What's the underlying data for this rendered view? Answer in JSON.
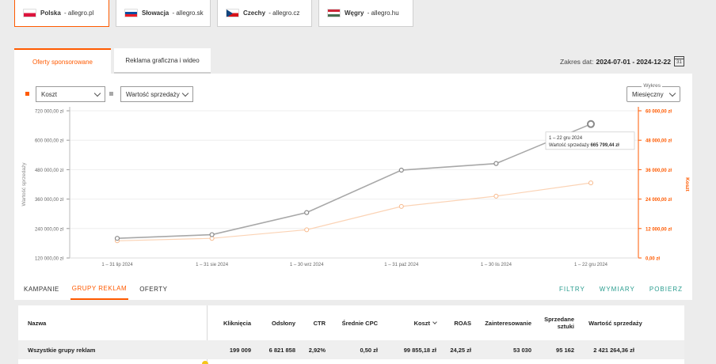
{
  "markets": [
    {
      "country": "Polska",
      "domain": "allegro.pl",
      "flag": "pl",
      "active": true
    },
    {
      "country": "Słowacja",
      "domain": "allegro.sk",
      "flag": "sk",
      "active": false
    },
    {
      "country": "Czechy",
      "domain": "allegro.cz",
      "flag": "cz",
      "active": false
    },
    {
      "country": "Węgry",
      "domain": "allegro.hu",
      "flag": "hu",
      "active": false
    }
  ],
  "tabs": {
    "sponsored": "Oferty sponsorowane",
    "display": "Reklama graficzna i wideo"
  },
  "date_range": {
    "label": "Zakres dat:",
    "value": "2024-07-01 - 2024-12-22",
    "calendar_day": "31"
  },
  "selectors": {
    "metric1": "Koszt",
    "metric2": "Wartość sprzedaży",
    "chart_legend": "Wykres",
    "chart_period": "Miesięczny"
  },
  "colors": {
    "accent": "#ff5a00",
    "sales_line": "#a8a8a8",
    "cost_line": "#fbd3b5",
    "teal": "#2a9d8f"
  },
  "chart_data": {
    "type": "line",
    "categories": [
      "1 – 31 lip 2024",
      "1 – 31 sie 2024",
      "1 – 30 wrz 2024",
      "1 – 31 paź 2024",
      "1 – 30 lis 2024",
      "1 – 22 gru 2024"
    ],
    "series": [
      {
        "name": "Wartość sprzedaży",
        "axis": "left",
        "color": "#a8a8a8",
        "values": [
          200000,
          215000,
          305000,
          478000,
          505000,
          665799.44
        ]
      },
      {
        "name": "Koszt",
        "axis": "right",
        "color": "#fbd3b5",
        "values": [
          7000,
          8000,
          11500,
          21000,
          25200,
          30600
        ]
      }
    ],
    "y_left": {
      "label": "Wartość sprzedaży",
      "min": 120000,
      "max": 720000,
      "ticks": [
        "120 000,00 zł",
        "240 000,00 zł",
        "360 000,00 zł",
        "480 000,00 zł",
        "600 000,00 zł",
        "720 000,00 zł"
      ]
    },
    "y_right": {
      "label": "Koszt",
      "min": 0,
      "max": 60000,
      "ticks": [
        "0,00 zł",
        "12 000,00 zł",
        "24 000,00 zł",
        "36 000,00 zł",
        "48 000,00 zł",
        "60 000,00 zł"
      ]
    },
    "tooltip": {
      "title": "1 – 22 gru 2024",
      "label": "Wartość sprzedaży",
      "value": "665 799,44 zł"
    }
  },
  "subtabs": [
    "KAMPANIE",
    "GRUPY REKLAM",
    "OFERTY"
  ],
  "actions": [
    "FILTRY",
    "WYMIARY",
    "POBIERZ"
  ],
  "table": {
    "headers": {
      "name": "Nazwa",
      "clicks": "Kliknięcia",
      "views": "Odsłony",
      "ctr": "CTR",
      "cpc": "Średnie CPC",
      "cost": "Koszt",
      "roas": "ROAS",
      "interest": "Zainteresowanie",
      "sold": "Sprzedane sztuki",
      "value": "Wartość sprzedaży"
    },
    "total_row": {
      "name": "Wszystkie grupy reklam",
      "clicks": "199 009",
      "views": "6 821 858",
      "ctr": "2,92%",
      "cpc": "0,50 zł",
      "cost": "99 855,18 zł",
      "roas": "24,25 zł",
      "interest": "53 030",
      "sold": "95 162",
      "value": "2 421 264,36 zł"
    }
  }
}
